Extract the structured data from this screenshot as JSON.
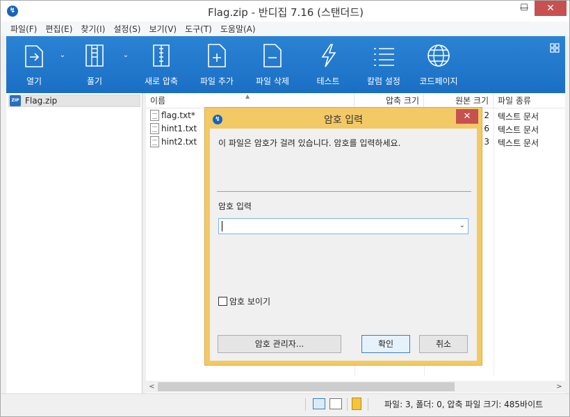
{
  "window": {
    "title": "Flag.zip - 반디집 7.16 (스탠더드)",
    "min": "—",
    "max": "☐",
    "close": "✕"
  },
  "menu": [
    "파일(F)",
    "편집(E)",
    "찾기(I)",
    "설정(S)",
    "보기(V)",
    "도구(T)",
    "도움말(A)"
  ],
  "toolbar": {
    "open": "열기",
    "extract": "풀기",
    "new_archive": "새로 압축",
    "add_file": "파일 추가",
    "delete_file": "파일 삭제",
    "test": "테스트",
    "column_settings": "칼럼 설정",
    "codepage": "코드페이지",
    "dropdown_arrow": "⌄"
  },
  "tree": {
    "archive": "Flag.zip",
    "zip_badge": "ZIP"
  },
  "list": {
    "headers": {
      "name": "이름",
      "compressed": "압축 크기",
      "original": "원본 크기",
      "type": "파일 종류"
    },
    "rows": [
      {
        "name": "flag.txt*",
        "original": "2",
        "type": "텍스트 문서"
      },
      {
        "name": "hint1.txt",
        "original": "6",
        "type": "텍스트 문서"
      },
      {
        "name": "hint2.txt",
        "original": "3",
        "type": "텍스트 문서"
      }
    ]
  },
  "scroll": {
    "left": "<",
    "right": ">"
  },
  "status": {
    "summary": "파일: 3, 폴더: 0, 압축 파일 크기: 485바이트"
  },
  "dialog": {
    "title": "암호 입력",
    "close": "✕",
    "message": "이 파일은 암호가 걸려 있습니다. 암호를 입력하세요.",
    "input_label": "암호 입력",
    "input_value": "",
    "show_password": "암호 보이기",
    "manager_button": "암호 관리자...",
    "ok_button": "확인",
    "cancel_button": "취소"
  },
  "colors": {
    "toolbar_blue": "#1e76c9",
    "dialog_frame": "#f3c966",
    "close_red": "#c75050"
  }
}
